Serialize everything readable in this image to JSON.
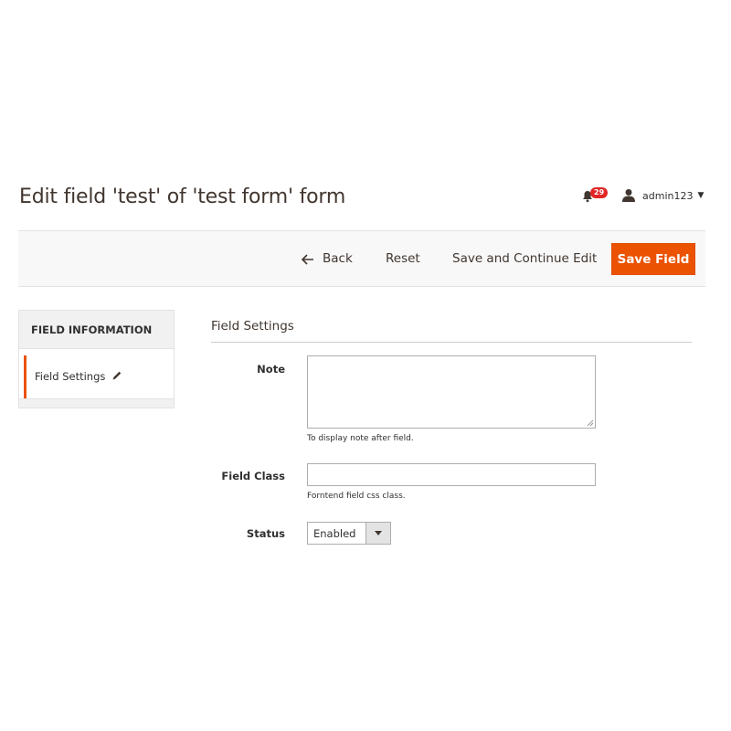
{
  "header": {
    "title": "Edit field 'test' of 'test form' form",
    "notifications_count": "29",
    "user_name": "admin123"
  },
  "actions": {
    "back_label": "Back",
    "reset_label": "Reset",
    "save_continue_label": "Save and Continue Edit",
    "save_label": "Save Field"
  },
  "sidebar": {
    "title": "FIELD INFORMATION",
    "items": [
      {
        "label": "Field Settings",
        "active": true
      }
    ]
  },
  "form": {
    "section_title": "Field Settings",
    "note": {
      "label": "Note",
      "value": "",
      "hint": "To display note after field."
    },
    "field_class": {
      "label": "Field Class",
      "value": "",
      "hint": "Forntend field css class."
    },
    "status": {
      "label": "Status",
      "selected": "Enabled"
    }
  },
  "colors": {
    "accent": "#eb5202",
    "badge": "#e22626",
    "bar_bg": "#f8f8f8"
  }
}
